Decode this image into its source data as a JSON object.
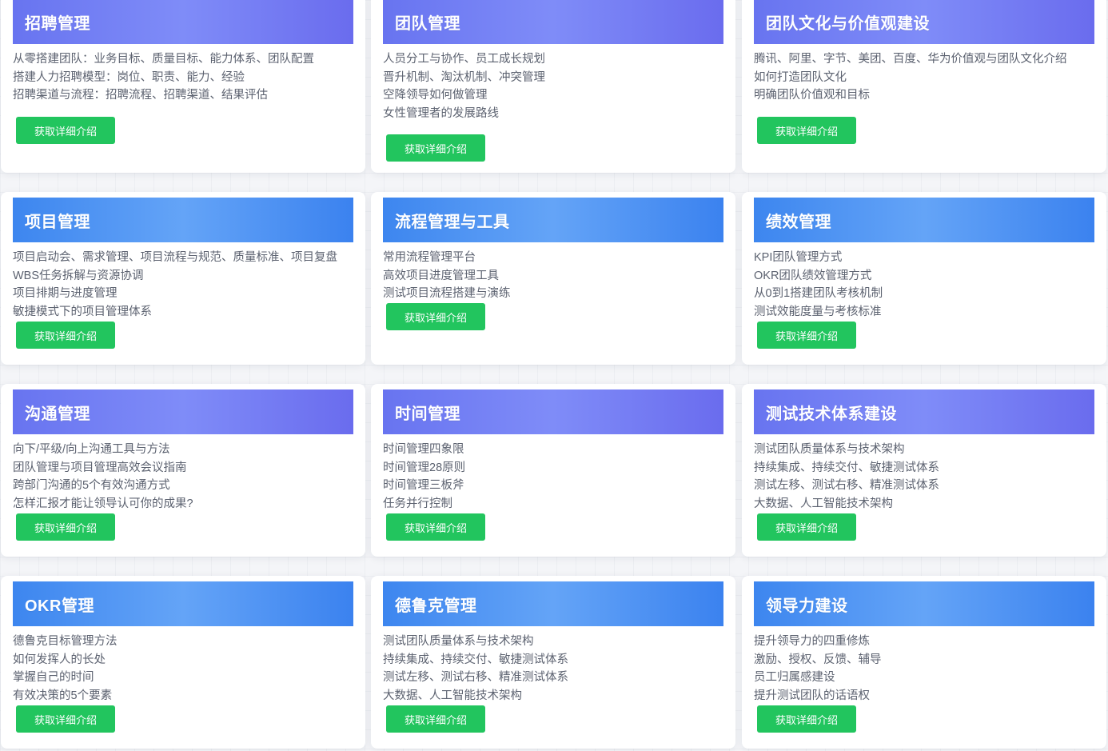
{
  "button_label": "获取详细介绍",
  "colors": {
    "purple_header": "#6b78f2",
    "blue_header": "#3d86ef",
    "button": "#22c55e",
    "card_bg": "#ffffff",
    "item_text": "#5c6270"
  },
  "cards": [
    {
      "title": "招聘管理",
      "items": [
        "从零搭建团队：业务目标、质量目标、能力体系、团队配置",
        "搭建人力招聘模型：岗位、职责、能力、经验",
        "招聘渠道与流程：招聘流程、招聘渠道、结果评估"
      ]
    },
    {
      "title": "团队管理",
      "items": [
        "人员分工与协作、员工成长规划",
        "晋升机制、淘汰机制、冲突管理",
        "空降领导如何做管理",
        "女性管理者的发展路线"
      ]
    },
    {
      "title": "团队文化与价值观建设",
      "items": [
        "腾讯、阿里、字节、美团、百度、华为价值观与团队文化介绍",
        "如何打造团队文化",
        "明确团队价值观和目标"
      ]
    },
    {
      "title": "项目管理",
      "items": [
        "项目启动会、需求管理、项目流程与规范、质量标准、项目复盘",
        "WBS任务拆解与资源协调",
        "项目排期与进度管理",
        "敏捷模式下的项目管理体系"
      ]
    },
    {
      "title": "流程管理与工具",
      "items": [
        "常用流程管理平台",
        "高效项目进度管理工具",
        "测试项目流程搭建与演练"
      ]
    },
    {
      "title": "绩效管理",
      "items": [
        "KPI团队管理方式",
        "OKR团队绩效管理方式",
        "从0到1搭建团队考核机制",
        "测试效能度量与考核标准"
      ]
    },
    {
      "title": "沟通管理",
      "items": [
        "向下/平级/向上沟通工具与方法",
        "团队管理与项目管理高效会议指南",
        "跨部门沟通的5个有效沟通方式",
        "怎样汇报才能让领导认可你的成果?"
      ]
    },
    {
      "title": "时间管理",
      "items": [
        "时间管理四象限",
        "时间管理28原则",
        "时间管理三板斧",
        "任务并行控制"
      ]
    },
    {
      "title": "测试技术体系建设",
      "items": [
        "测试团队质量体系与技术架构",
        "持续集成、持续交付、敏捷测试体系",
        "测试左移、测试右移、精准测试体系",
        "大数据、人工智能技术架构"
      ]
    },
    {
      "title": "OKR管理",
      "items": [
        "德鲁克目标管理方法",
        "如何发挥人的长处",
        "掌握自己的时间",
        "有效决策的5个要素"
      ]
    },
    {
      "title": "德鲁克管理",
      "items": [
        "测试团队质量体系与技术架构",
        "持续集成、持续交付、敏捷测试体系",
        "测试左移、测试右移、精准测试体系",
        "大数据、人工智能技术架构"
      ]
    },
    {
      "title": "领导力建设",
      "items": [
        "提升领导力的四重修炼",
        "激励、授权、反馈、辅导",
        "员工归属感建设",
        "提升测试团队的话语权"
      ]
    }
  ]
}
